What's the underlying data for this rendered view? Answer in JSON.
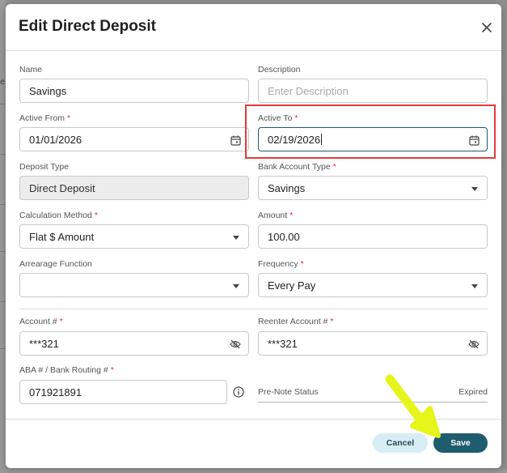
{
  "background": {
    "stub_text": "e"
  },
  "dialog": {
    "title": "Edit Direct Deposit",
    "close_icon": "close-icon"
  },
  "fields": {
    "name": {
      "label": "Name",
      "value": "Savings"
    },
    "description": {
      "label": "Description",
      "placeholder": "Enter Description",
      "value": ""
    },
    "active_from": {
      "label": "Active From",
      "required": "*",
      "value": "01/01/2026",
      "icon": "calendar-icon"
    },
    "active_to": {
      "label": "Active To",
      "required": "*",
      "value": "02/19/2026",
      "icon": "calendar-icon"
    },
    "deposit_type": {
      "label": "Deposit Type",
      "value": "Direct Deposit"
    },
    "bank_account_type": {
      "label": "Bank Account Type",
      "required": "*",
      "value": "Savings"
    },
    "calculation_method": {
      "label": "Calculation Method",
      "required": "*",
      "value": "Flat $ Amount"
    },
    "amount": {
      "label": "Amount",
      "required": "*",
      "value": "100.00"
    },
    "arrearage_function": {
      "label": "Arrearage Function",
      "value": ""
    },
    "frequency": {
      "label": "Frequency",
      "required": "*",
      "value": "Every Pay"
    },
    "account_number": {
      "label": "Account #",
      "required": "*",
      "value": "***321",
      "icon": "eye-off-icon"
    },
    "reenter_account_number": {
      "label": "Reenter Account #",
      "required": "*",
      "value": "***321",
      "icon": "eye-off-icon"
    },
    "aba_routing": {
      "label": "ABA # / Bank Routing #",
      "required": "*",
      "value": "071921891",
      "icon": "info-icon"
    },
    "pre_note_status": {
      "label": "Pre-Note Status",
      "value": "Expired"
    }
  },
  "buttons": {
    "cancel": "Cancel",
    "save": "Save"
  },
  "colors": {
    "primary": "#1f5c6e",
    "secondary_button": "#d6eef3",
    "required": "#d9302c",
    "highlight_box": "#e23b3b",
    "annotation_arrow": "#e6f51a"
  }
}
